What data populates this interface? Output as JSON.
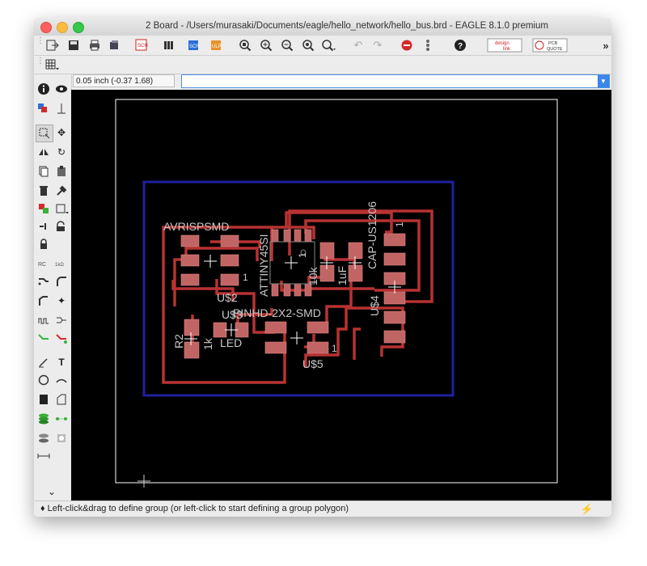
{
  "window": {
    "title": "2 Board - /Users/murasaki/Documents/eagle/hello_network/hello_bus.brd - EAGLE 8.1.0 premium"
  },
  "toolbar": {
    "overflow": "»",
    "design_link_line1": "design",
    "design_link_line2": "link",
    "pcb_quote_line1": "PCB",
    "pcb_quote_line2": "QUOTE"
  },
  "cmdbar": {
    "coordinates": "0.05 inch (-0.37 1.68)",
    "command_value": ""
  },
  "board": {
    "labels": {
      "avrisp": "AVRISPSMD",
      "attiny": "ATTINY45SI",
      "r10k": "10k",
      "r1uf": "1uF",
      "cap": "CAP-US1206",
      "u2": "U$2",
      "u3": "U$3",
      "u4": "U$4",
      "u5": "U$5",
      "pinhd": "PINHD-2X2-SMD",
      "r2": "R2",
      "r1k": "1k",
      "led": "LED",
      "pin1_a": "1",
      "pin1_b": "1",
      "pin1_c": "1",
      "pin1_d": "1"
    },
    "colors": {
      "background": "#000000",
      "trace": "#b83232",
      "pad": "#c06464",
      "outline": "#2020a0",
      "frame": "#ffffff",
      "text": "#c8c8c8"
    }
  },
  "status": {
    "message": "Left-click&drag to define group (or left-click to start defining a group polygon)"
  }
}
